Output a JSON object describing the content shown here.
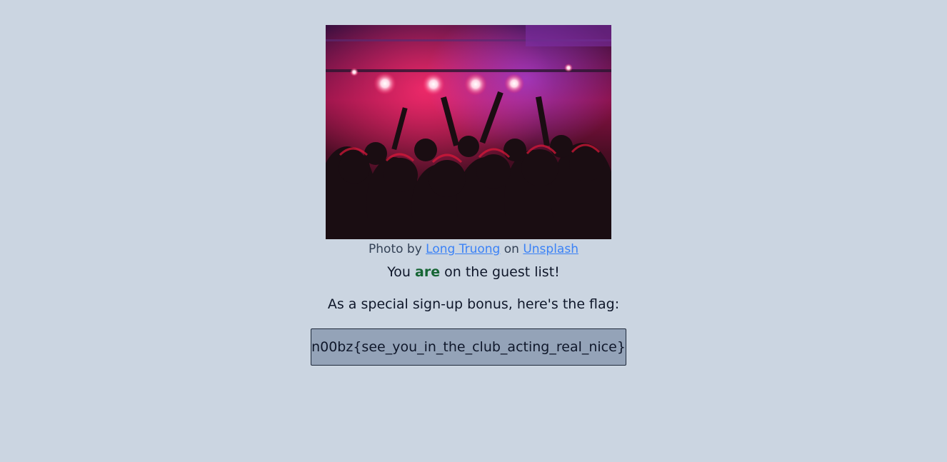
{
  "photo": {
    "alt": "Concert crowd under red stage lights"
  },
  "caption": {
    "prefix": "Photo by ",
    "author": "Long Truong",
    "middle": " on ",
    "site": "Unsplash"
  },
  "guest": {
    "before": "You ",
    "emphasis": "are",
    "after": " on the guest list!"
  },
  "bonus": {
    "text": "As a special sign-up bonus, here's the flag:"
  },
  "flag": {
    "value": "n00bz{see_you_in_the_club_acting_real_nice}"
  },
  "colors": {
    "background": "#cbd5e1",
    "link": "#3b82f6",
    "emphasis": "#166534",
    "flag_box": "#94a3b8"
  }
}
